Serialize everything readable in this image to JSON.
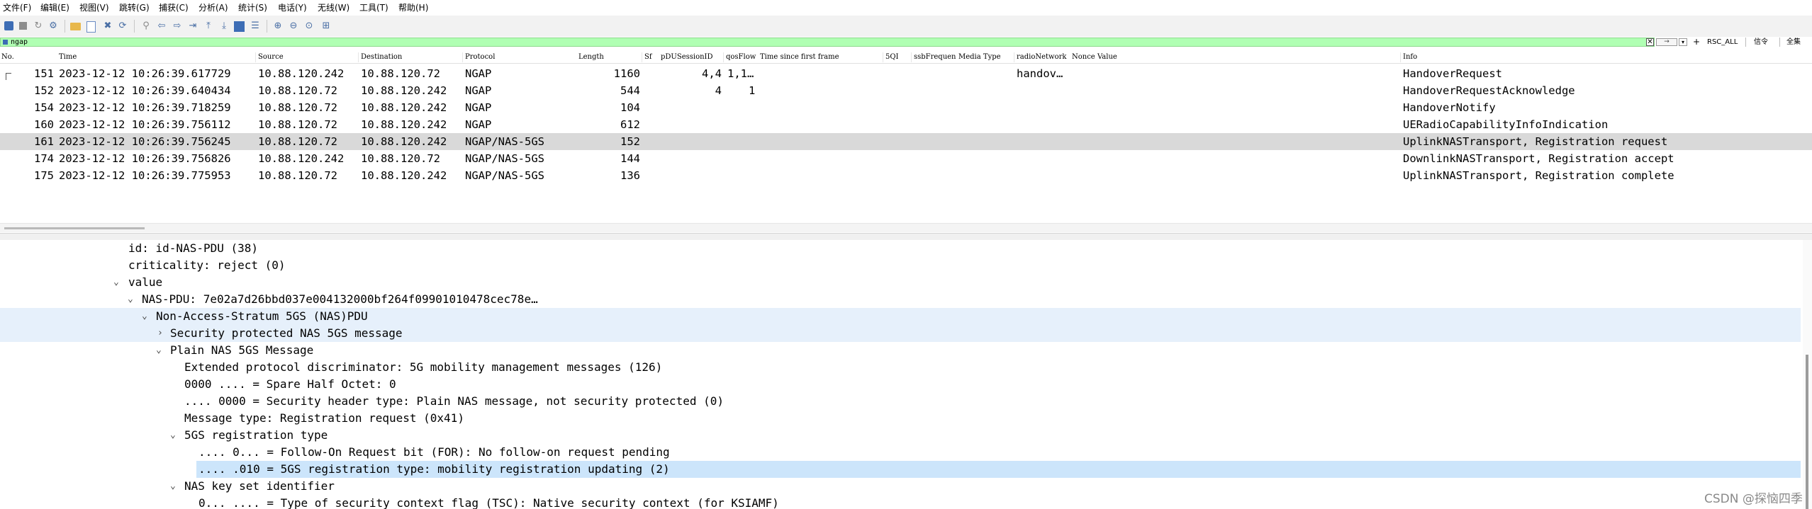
{
  "menubar": {
    "items": [
      "文件(F)",
      "编辑(E)",
      "视图(V)",
      "跳转(G)",
      "捕获(C)",
      "分析(A)",
      "统计(S)",
      "电话(Y)",
      "无线(W)",
      "工具(T)",
      "帮助(H)"
    ]
  },
  "filter": {
    "value": "ngap",
    "clear_glyph": "✕",
    "apply_glyph": "→",
    "history_glyph": "▾",
    "add_glyph": "+",
    "buttons": [
      "RSC_ALL",
      "信令",
      "全集"
    ]
  },
  "packet_list": {
    "columns": [
      "No.",
      "Time",
      "Source",
      "Destination",
      "Protocol",
      "Length",
      "Sf",
      "pDUSessionID",
      "qosFlow",
      "Time since first frame",
      "5QI",
      "ssbFrequen",
      "Media Type",
      "radioNetwork",
      "Nonce",
      "Value",
      "Info"
    ],
    "rows": [
      {
        "no": "151",
        "time": "2023-12-12 10:26:39.617729",
        "src": "10.88.120.242",
        "dst": "10.88.120.72",
        "proto": "NGAP",
        "len": "1160",
        "pdu": "4,4",
        "qos": "1,1…",
        "radio": "handov…",
        "info": "HandoverRequest"
      },
      {
        "no": "152",
        "time": "2023-12-12 10:26:39.640434",
        "src": "10.88.120.72",
        "dst": "10.88.120.242",
        "proto": "NGAP",
        "len": "544",
        "pdu": "4",
        "qos": "1",
        "radio": "",
        "info": "HandoverRequestAcknowledge"
      },
      {
        "no": "154",
        "time": "2023-12-12 10:26:39.718259",
        "src": "10.88.120.72",
        "dst": "10.88.120.242",
        "proto": "NGAP",
        "len": "104",
        "pdu": "",
        "qos": "",
        "radio": "",
        "info": "HandoverNotify"
      },
      {
        "no": "160",
        "time": "2023-12-12 10:26:39.756112",
        "src": "10.88.120.72",
        "dst": "10.88.120.242",
        "proto": "NGAP",
        "len": "612",
        "pdu": "",
        "qos": "",
        "radio": "",
        "info": "UERadioCapabilityInfoIndication"
      },
      {
        "no": "161",
        "time": "2023-12-12 10:26:39.756245",
        "src": "10.88.120.72",
        "dst": "10.88.120.242",
        "proto": "NGAP/NAS-5GS",
        "len": "152",
        "pdu": "",
        "qos": "",
        "radio": "",
        "info": "UplinkNASTransport, Registration request"
      },
      {
        "no": "174",
        "time": "2023-12-12 10:26:39.756826",
        "src": "10.88.120.242",
        "dst": "10.88.120.72",
        "proto": "NGAP/NAS-5GS",
        "len": "144",
        "pdu": "",
        "qos": "",
        "radio": "",
        "info": "DownlinkNASTransport, Registration accept"
      },
      {
        "no": "175",
        "time": "2023-12-12 10:26:39.775953",
        "src": "10.88.120.72",
        "dst": "10.88.120.242",
        "proto": "NGAP/NAS-5GS",
        "len": "136",
        "pdu": "",
        "qos": "",
        "radio": "",
        "info": "UplinkNASTransport, Registration complete"
      }
    ],
    "selected_no": "161"
  },
  "detail_tree": {
    "rows": [
      {
        "arrow": "",
        "text": "id: id-NAS-PDU (38)"
      },
      {
        "arrow": "",
        "text": "criticality: reject (0)"
      },
      {
        "arrow": "⌄",
        "text": "value"
      },
      {
        "arrow": "⌄",
        "text": "NAS-PDU: 7e02a7d26bbd037e004132000bf264f09901010478cec78e…"
      },
      {
        "arrow": "⌄",
        "text": "Non-Access-Stratum 5GS (NAS)PDU"
      },
      {
        "arrow": "›",
        "text": "Security protected NAS 5GS message"
      },
      {
        "arrow": "⌄",
        "text": "Plain NAS 5GS Message"
      },
      {
        "arrow": "",
        "text": "Extended protocol discriminator: 5G mobility management messages (126)"
      },
      {
        "arrow": "",
        "text": "0000 .... = Spare Half Octet: 0"
      },
      {
        "arrow": "",
        "text": ".... 0000 = Security header type: Plain NAS message, not security protected (0)"
      },
      {
        "arrow": "",
        "text": "Message type: Registration request (0x41)"
      },
      {
        "arrow": "⌄",
        "text": "5GS registration type"
      },
      {
        "arrow": "",
        "text": ".... 0... = Follow-On Request bit (FOR): No follow-on request pending"
      },
      {
        "arrow": "",
        "text": ".... .010 = 5GS registration type: mobility registration updating (2)"
      },
      {
        "arrow": "⌄",
        "text": "NAS key set identifier"
      },
      {
        "arrow": "",
        "text": "0... .... = Type of security context flag (TSC): Native security context (for KSIAMF)"
      }
    ]
  },
  "watermark": "CSDN @探恼四季"
}
